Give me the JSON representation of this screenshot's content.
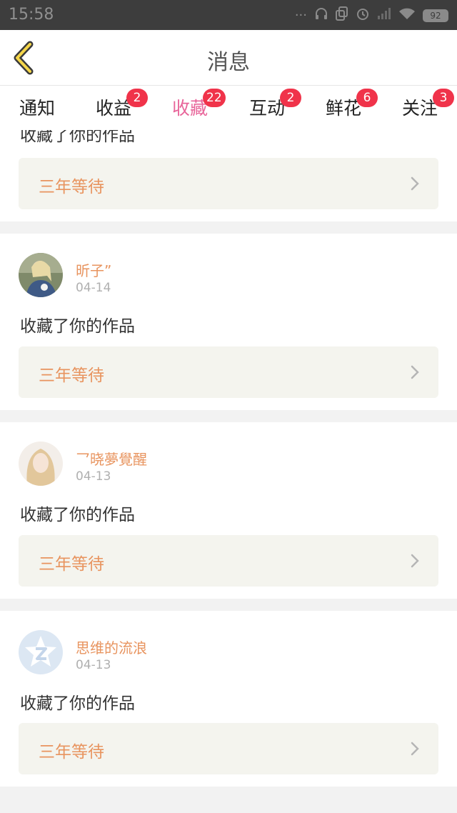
{
  "status_bar": {
    "time": "15:58",
    "battery": "92"
  },
  "header": {
    "title": "消息"
  },
  "tabs": [
    {
      "label": "通知",
      "badge": ""
    },
    {
      "label": "收益",
      "badge": "2"
    },
    {
      "label": "收藏",
      "badge": "22"
    },
    {
      "label": "互动",
      "badge": "2"
    },
    {
      "label": "鲜花",
      "badge": "6"
    },
    {
      "label": "关注",
      "badge": "3"
    }
  ],
  "feed": {
    "partial_item": {
      "action": "收藏了你的作品",
      "work_title": "三年等待"
    },
    "items": [
      {
        "username": "昕子”",
        "date": "04-14",
        "action": "收藏了你的作品",
        "work_title": "三年等待"
      },
      {
        "username": "乛晓夢覺醒",
        "date": "04-13",
        "action": "收藏了你的作品",
        "work_title": "三年等待"
      },
      {
        "username": "思维的流浪",
        "date": "04-13",
        "action": "收藏了你的作品",
        "work_title": "三年等待"
      }
    ]
  },
  "colors": {
    "accent_pink": "#e8659a",
    "username_orange": "#e8945f",
    "badge_red": "#f0334a"
  }
}
